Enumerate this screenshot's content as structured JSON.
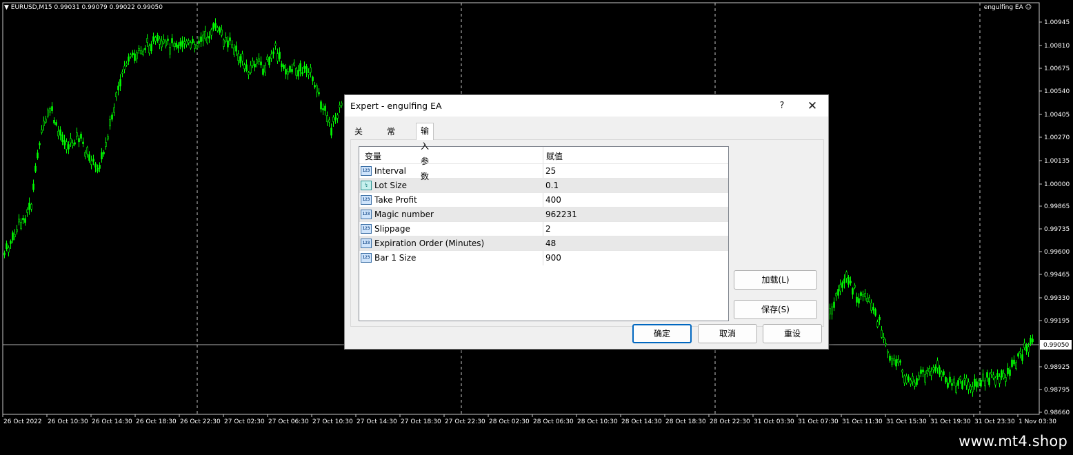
{
  "chart": {
    "symbol_info": "▼ EURUSD,M15  0.99031 0.99079 0.99022 0.99050",
    "ea_label": "engulfing EA ☺",
    "current_price": "0.99050",
    "price_labels": [
      "1.00945",
      "1.00810",
      "1.00675",
      "1.00540",
      "1.00405",
      "1.00270",
      "1.00135",
      "1.00000",
      "0.99865",
      "0.99735",
      "0.99600",
      "0.99465",
      "0.99330",
      "0.99195",
      "0.98925",
      "0.98795",
      "0.98660"
    ],
    "time_labels": [
      "26 Oct 2022",
      "26 Oct 10:30",
      "26 Oct 14:30",
      "26 Oct 18:30",
      "26 Oct 22:30",
      "27 Oct 02:30",
      "27 Oct 06:30",
      "27 Oct 10:30",
      "27 Oct 14:30",
      "27 Oct 18:30",
      "27 Oct 22:30",
      "28 Oct 02:30",
      "28 Oct 06:30",
      "28 Oct 10:30",
      "28 Oct 14:30",
      "28 Oct 18:30",
      "28 Oct 22:30",
      "31 Oct 03:30",
      "31 Oct 07:30",
      "31 Oct 11:30",
      "31 Oct 15:30",
      "31 Oct 19:30",
      "31 Oct 23:30",
      "1 Nov 03:30"
    ],
    "colors": {
      "background": "#000000",
      "candles": "#00ff00",
      "grid": "#c8c8c8",
      "text": "#ffffff"
    }
  },
  "dialog": {
    "title": "Expert - engulfing EA",
    "help": "?",
    "close": "✕",
    "tabs": [
      {
        "label": "关于"
      },
      {
        "label": "常用"
      },
      {
        "label": "输入参数"
      }
    ],
    "active_tab": "输入参数",
    "grid": {
      "col_variable": "变量",
      "col_value": "赋值",
      "rows": [
        {
          "icon": "int-icon",
          "icon_text": "123",
          "name": "Interval",
          "value": "25"
        },
        {
          "icon": "double-icon",
          "icon_text": "½",
          "name": "Lot Size",
          "value": "0.1"
        },
        {
          "icon": "int-icon",
          "icon_text": "123",
          "name": "Take Profit",
          "value": "400"
        },
        {
          "icon": "int-icon",
          "icon_text": "123",
          "name": "Magic number",
          "value": "962231"
        },
        {
          "icon": "int-icon",
          "icon_text": "123",
          "name": "Slippage",
          "value": "2"
        },
        {
          "icon": "int-icon",
          "icon_text": "123",
          "name": "Expiration Order (Minutes)",
          "value": "48"
        },
        {
          "icon": "int-icon",
          "icon_text": "123",
          "name": "Bar 1 Size",
          "value": "900"
        }
      ]
    },
    "buttons": {
      "load": "加载(L)",
      "save": "保存(S)",
      "ok": "确定",
      "cancel": "取消",
      "reset": "重设"
    }
  },
  "watermark": "www.mt4.shop"
}
